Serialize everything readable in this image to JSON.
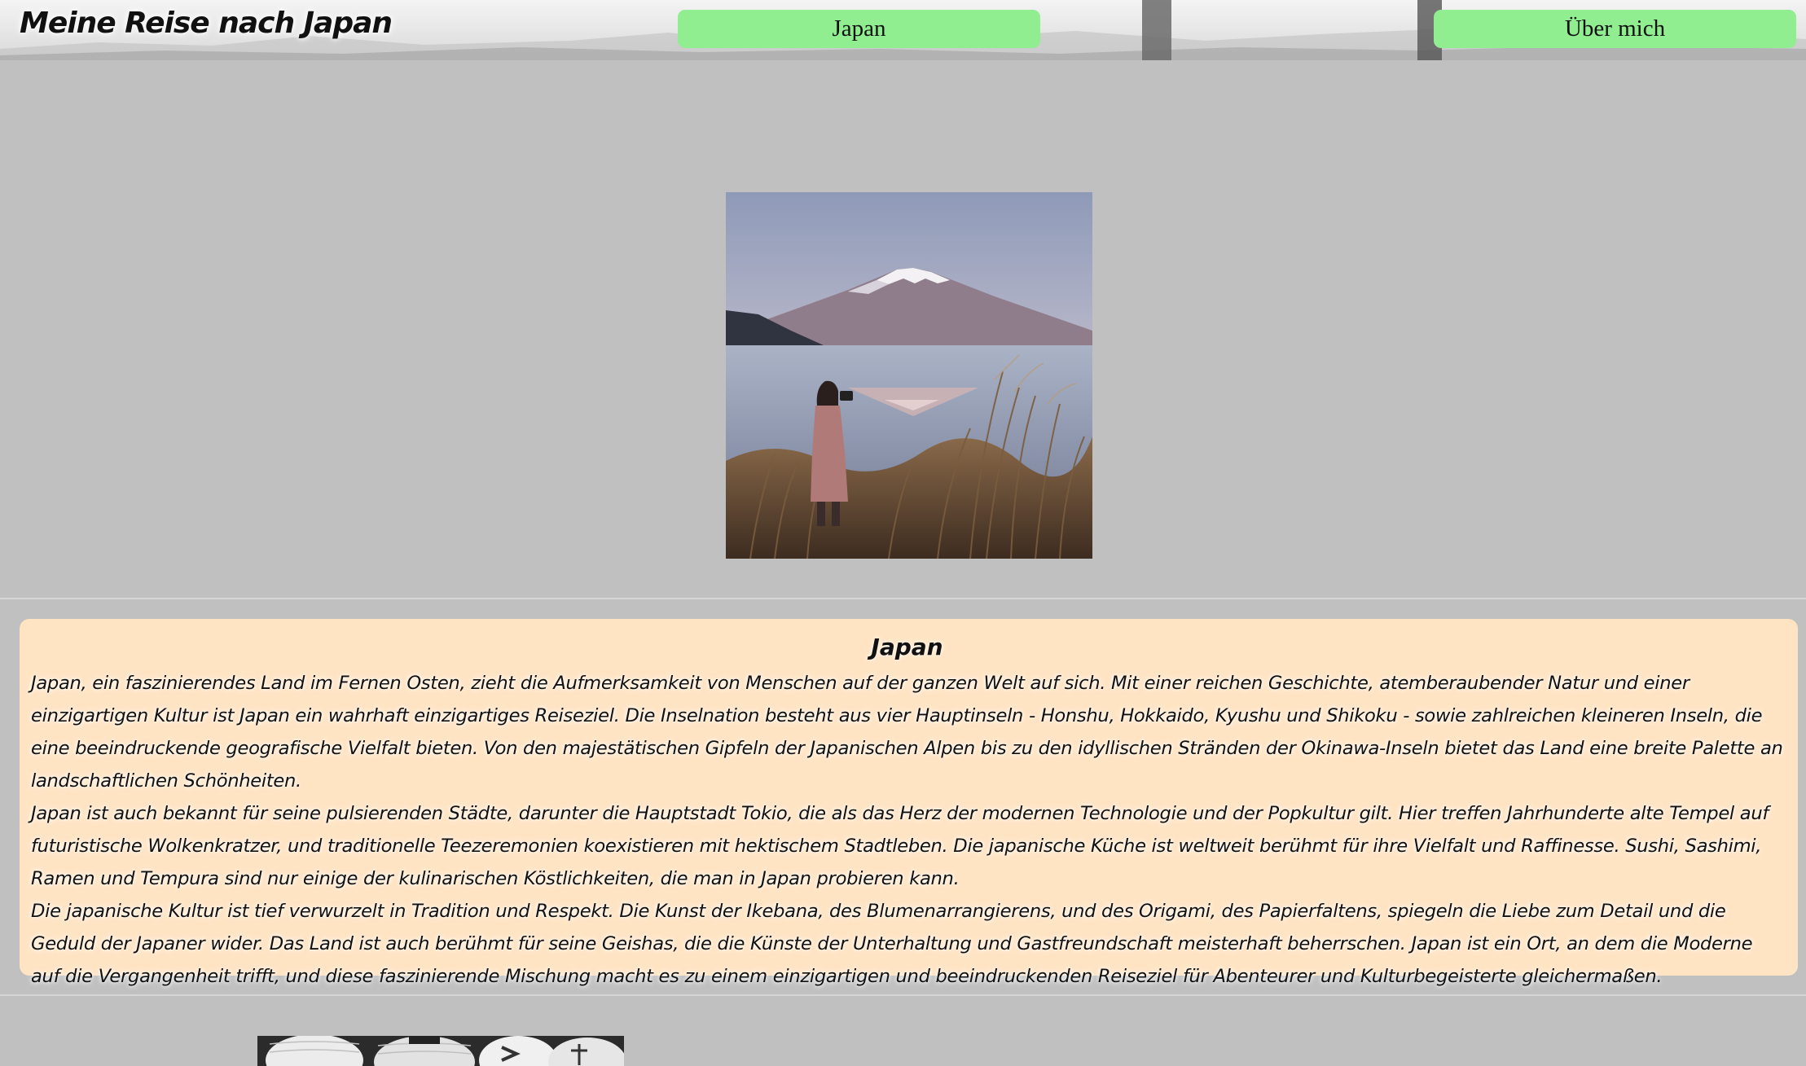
{
  "header": {
    "title": "Meine Reise nach Japan",
    "nav": [
      {
        "label": "Japan"
      },
      {
        "label": "Über mich"
      }
    ]
  },
  "article": {
    "heading": "Japan",
    "paragraphs": [
      "Japan, ein faszinierendes Land im Fernen Osten, zieht die Aufmerksamkeit von Menschen auf der ganzen Welt auf sich. Mit einer reichen Geschichte, atemberaubender Natur und einer einzigartigen Kultur ist Japan ein wahrhaft einzigartiges Reiseziel. Die Inselnation besteht aus vier Hauptinseln - Honshu, Hokkaido, Kyushu und Shikoku - sowie zahlreichen kleineren Inseln, die eine beeindruckende geografische Vielfalt bieten. Von den majestätischen Gipfeln der Japanischen Alpen bis zu den idyllischen Stränden der Okinawa-Inseln bietet das Land eine breite Palette an landschaftlichen Schönheiten.",
      "Japan ist auch bekannt für seine pulsierenden Städte, darunter die Hauptstadt Tokio, die als das Herz der modernen Technologie und der Popkultur gilt. Hier treffen Jahrhunderte alte Tempel auf futuristische Wolkenkratzer, und traditionelle Teezeremonien koexistieren mit hektischem Stadtleben. Die japanische Küche ist weltweit berühmt für ihre Vielfalt und Raffinesse. Sushi, Sashimi, Ramen und Tempura sind nur einige der kulinarischen Köstlichkeiten, die man in Japan probieren kann.",
      "Die japanische Kultur ist tief verwurzelt in Tradition und Respekt. Die Kunst der Ikebana, des Blumenarrangierens, und des Origami, des Papierfaltens, spiegeln die Liebe zum Detail und die Geduld der Japaner wider. Das Land ist auch berühmt für seine Geishas, die die Künste der Unterhaltung und Gastfreundschaft meisterhaft beherrschen. Japan ist ein Ort, an dem die Moderne auf die Vergangenheit trifft, und diese faszinierende Mischung macht es zu einem einzigartigen und beeindruckenden Reiseziel für Abenteurer und Kulturbegeisterte gleichermaßen."
    ]
  },
  "colors": {
    "page_background": "#c0c0c0",
    "nav_button": "#90ee90",
    "card_background": "#ffe4c4"
  },
  "images": {
    "hero": "mount-fuji-photo",
    "bottom": "paper-lanterns-photo"
  }
}
